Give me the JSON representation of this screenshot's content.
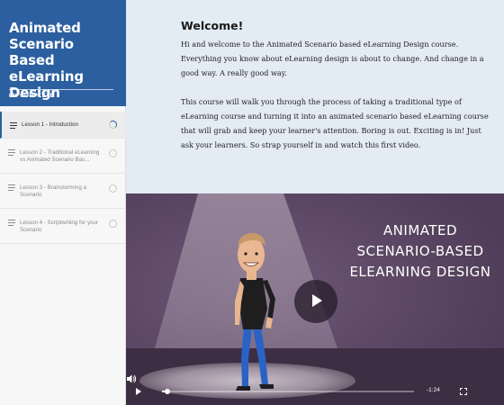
{
  "sidebar": {
    "course_title": "Animated Scenario Based eLearning Design",
    "progress_label": "0% COMPLETE",
    "progress_value": 0,
    "lessons": [
      {
        "label": "Lesson 1 - Introduction",
        "active": true
      },
      {
        "label": "Lesson 2 - Traditional eLearning vs Animated Scenario Bas...",
        "active": false
      },
      {
        "label": "Lesson 3 - Brainstorming a Scenario",
        "active": false
      },
      {
        "label": "Lesson 4 - Scriptwriting for your Scenario",
        "active": false
      }
    ]
  },
  "content": {
    "heading": "Welcome!",
    "paragraph_1": "Hi and welcome to the Animated Scenario based eLearning Design course. Everything you know about eLearning design is about to change. And change in a good way. A really good way.",
    "paragraph_2": "This course will walk you through the process of taking a traditional type of eLearning course and turning it into an animated scenario based eLearning course that will grab and keep your learner's attention. Boring is out. Exciting is in! Just ask your learners. So strap yourself in and watch this first video."
  },
  "video": {
    "title_lines": [
      "ANIMATED",
      "SCENARIO-BASED",
      "ELEARNING DESIGN"
    ],
    "time_remaining": "-1:24",
    "playback_progress": 0.02,
    "colors": {
      "background": "#5c4766",
      "spotlight": "#8b7a8f",
      "floor": "#3d2e44"
    }
  },
  "colors": {
    "brand_blue": "#2c5fa0",
    "content_bg": "#e3ebf5"
  },
  "icons": {
    "lesson": "text-lines-icon",
    "status": "progress-circle-icon",
    "play": "play-icon",
    "fullscreen": "fullscreen-icon",
    "volume": "volume-icon"
  }
}
